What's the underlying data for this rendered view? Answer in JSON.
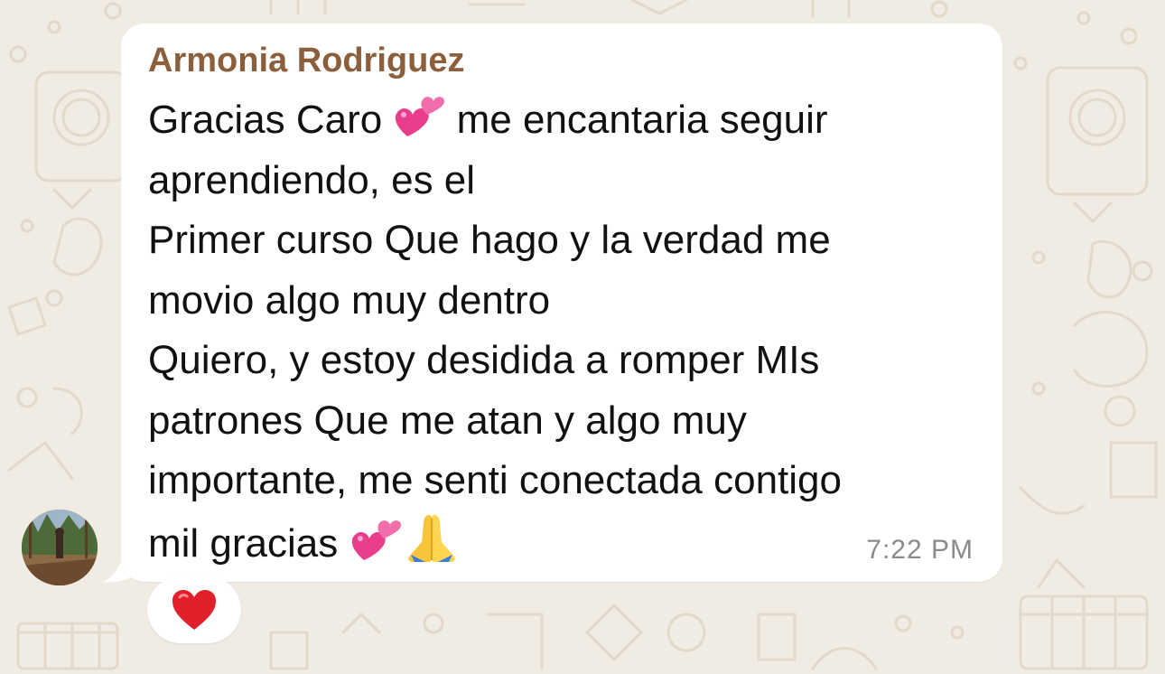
{
  "message": {
    "sender_name": "Armonia Rodriguez",
    "lines": {
      "l1_before": "Gracias Caro ",
      "l1_after": " me encantaria seguir",
      "l2": "aprendiendo, es el",
      "l3": "Primer curso Que hago y la verdad me",
      "l4": "movio algo muy dentro",
      "l5": "Quiero, y estoy desidida a romper MIs",
      "l6": "patrones Que me atan y algo muy",
      "l7": "importante, me senti conectada contigo",
      "l8_before": "mil gracias "
    },
    "emojis": {
      "hearts": "two-hearts-emoji",
      "pray": "folded-hands-emoji"
    },
    "timestamp": "7:22 PM"
  },
  "reaction": {
    "emoji": "red-heart-emoji"
  },
  "colors": {
    "background": "#F0EBE3",
    "bubble": "#FFFFFF",
    "sender_name": "#8B5E3C",
    "timestamp": "#8A8A8A"
  }
}
